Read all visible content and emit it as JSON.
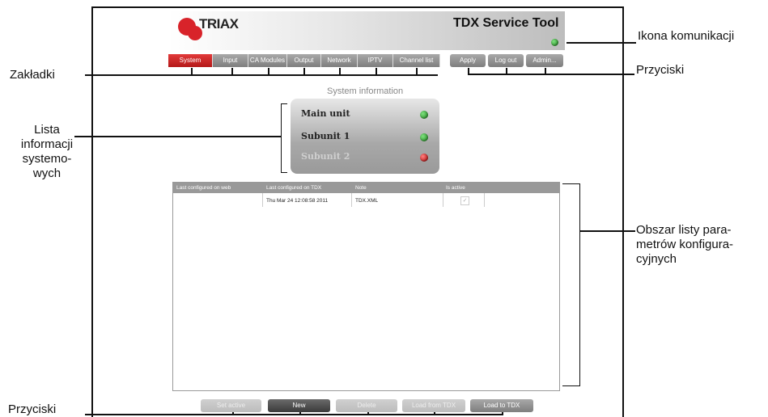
{
  "app": {
    "logo_text": "TRIAX",
    "title": "TDX Service Tool"
  },
  "tabs": [
    "System",
    "Input",
    "CA Modules",
    "Output",
    "Network",
    "IPTV",
    "Channel list"
  ],
  "active_tab": "System",
  "top_buttons": [
    "Apply",
    "Log out",
    "Admin..."
  ],
  "system_info": {
    "title": "System information",
    "units": [
      {
        "label": "Main unit",
        "status": "green"
      },
      {
        "label": "Subunit 1",
        "status": "green"
      },
      {
        "label": "Subunit 2",
        "status": "red"
      }
    ]
  },
  "table": {
    "columns": [
      "Last configured on web",
      "Last configured on TDX",
      "Note",
      "Is active"
    ],
    "rows": [
      {
        "web": "",
        "tdx": "Thu Mar 24 12:08:58 2011",
        "note": "TDX.XML",
        "active": "✓"
      }
    ]
  },
  "bottom_buttons": [
    "Set active",
    "New",
    "Delete",
    "Load from TDX",
    "Load to TDX"
  ],
  "annotations": {
    "tabs": "Zakładki",
    "comm_icon": "Ikona komunikacji",
    "buttons_top": "Przyciski",
    "syslist": [
      "Lista",
      "informacji",
      "systemo-",
      "wych"
    ],
    "paramlist": [
      "Obszar listy para-",
      "metrów konfigura-",
      "cyjnych"
    ],
    "buttons_bottom": "Przyciski"
  },
  "colors": {
    "accent": "#d8232a",
    "led_green": "#1d8a1d",
    "led_red": "#b00000"
  }
}
